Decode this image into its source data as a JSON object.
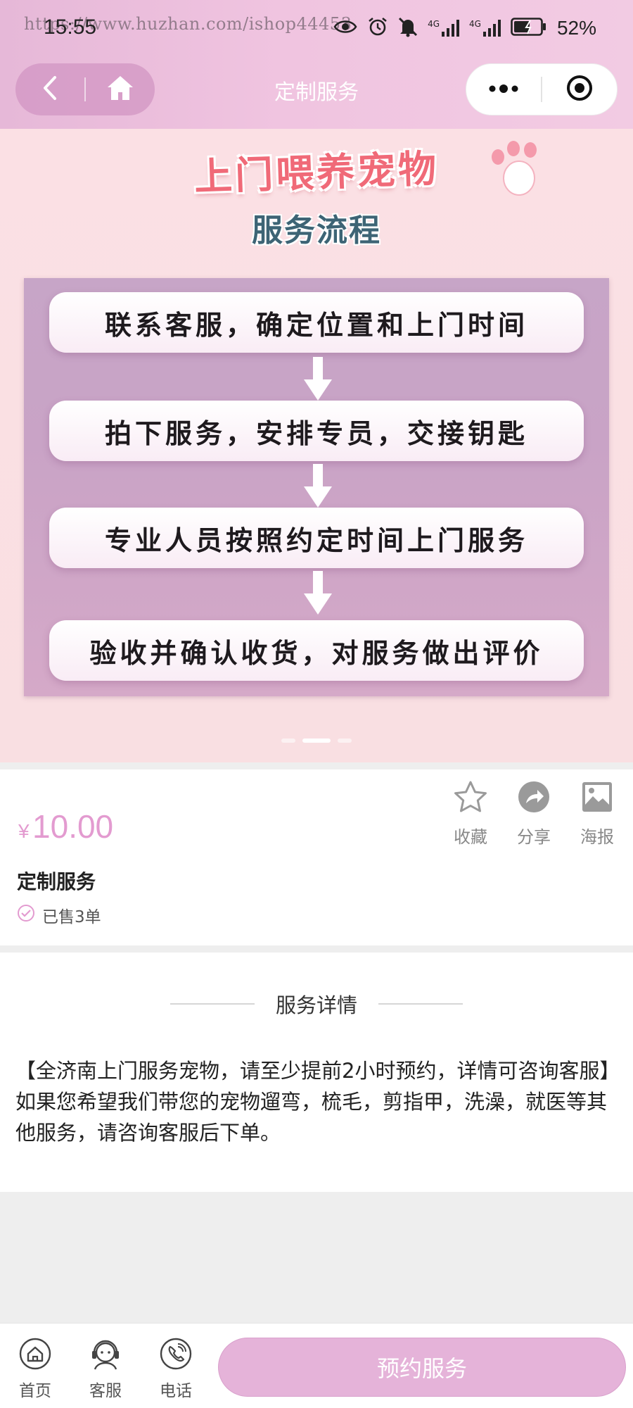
{
  "status_bar": {
    "time": "15:55",
    "watermark": "https://www.huzhan.com/ishop44453",
    "battery_pct": "52%",
    "network_labels": [
      "4G",
      "4G"
    ]
  },
  "nav": {
    "title": "定制服务",
    "back_icon": "chevron-left-icon",
    "home_icon": "home-icon",
    "more_icon": "more-dots-icon",
    "close_icon": "target-circle-icon"
  },
  "banner": {
    "title": "上门喂养宠物",
    "subtitle": "服务流程",
    "steps": [
      "联系客服，确定位置和上门时间",
      "拍下服务，安排专员，交接钥匙",
      "专业人员按照约定时间上门服务",
      "验收并确认收货，对服务做出评价"
    ],
    "active_slide": 2,
    "slide_count": 3
  },
  "product": {
    "currency": "¥",
    "price": "10.00",
    "name": "定制服务",
    "sold": "已售3单",
    "actions": [
      {
        "label": "收藏",
        "icon": "star-icon"
      },
      {
        "label": "分享",
        "icon": "share-arrow-icon"
      },
      {
        "label": "海报",
        "icon": "image-icon"
      }
    ]
  },
  "details": {
    "header": "服务详情",
    "paragraphs": [
      "【全济南上门服务宠物，请至少提前2小时预约，详情可咨询客服】",
      "如果您希望我们带您的宠物遛弯，梳毛，剪指甲，洗澡，就医等其他服务，请咨询客服后下单。"
    ]
  },
  "bottom_bar": {
    "tabs": [
      {
        "label": "首页",
        "icon": "home-icon"
      },
      {
        "label": "客服",
        "icon": "customer-service-icon"
      },
      {
        "label": "电话",
        "icon": "phone-icon"
      }
    ],
    "book_button": "预约服务"
  },
  "colors": {
    "accent": "#e5b3d9",
    "price": "#e39bd0",
    "header_bg": "#f0c4e0",
    "banner_bg": "#fbe0e4"
  }
}
